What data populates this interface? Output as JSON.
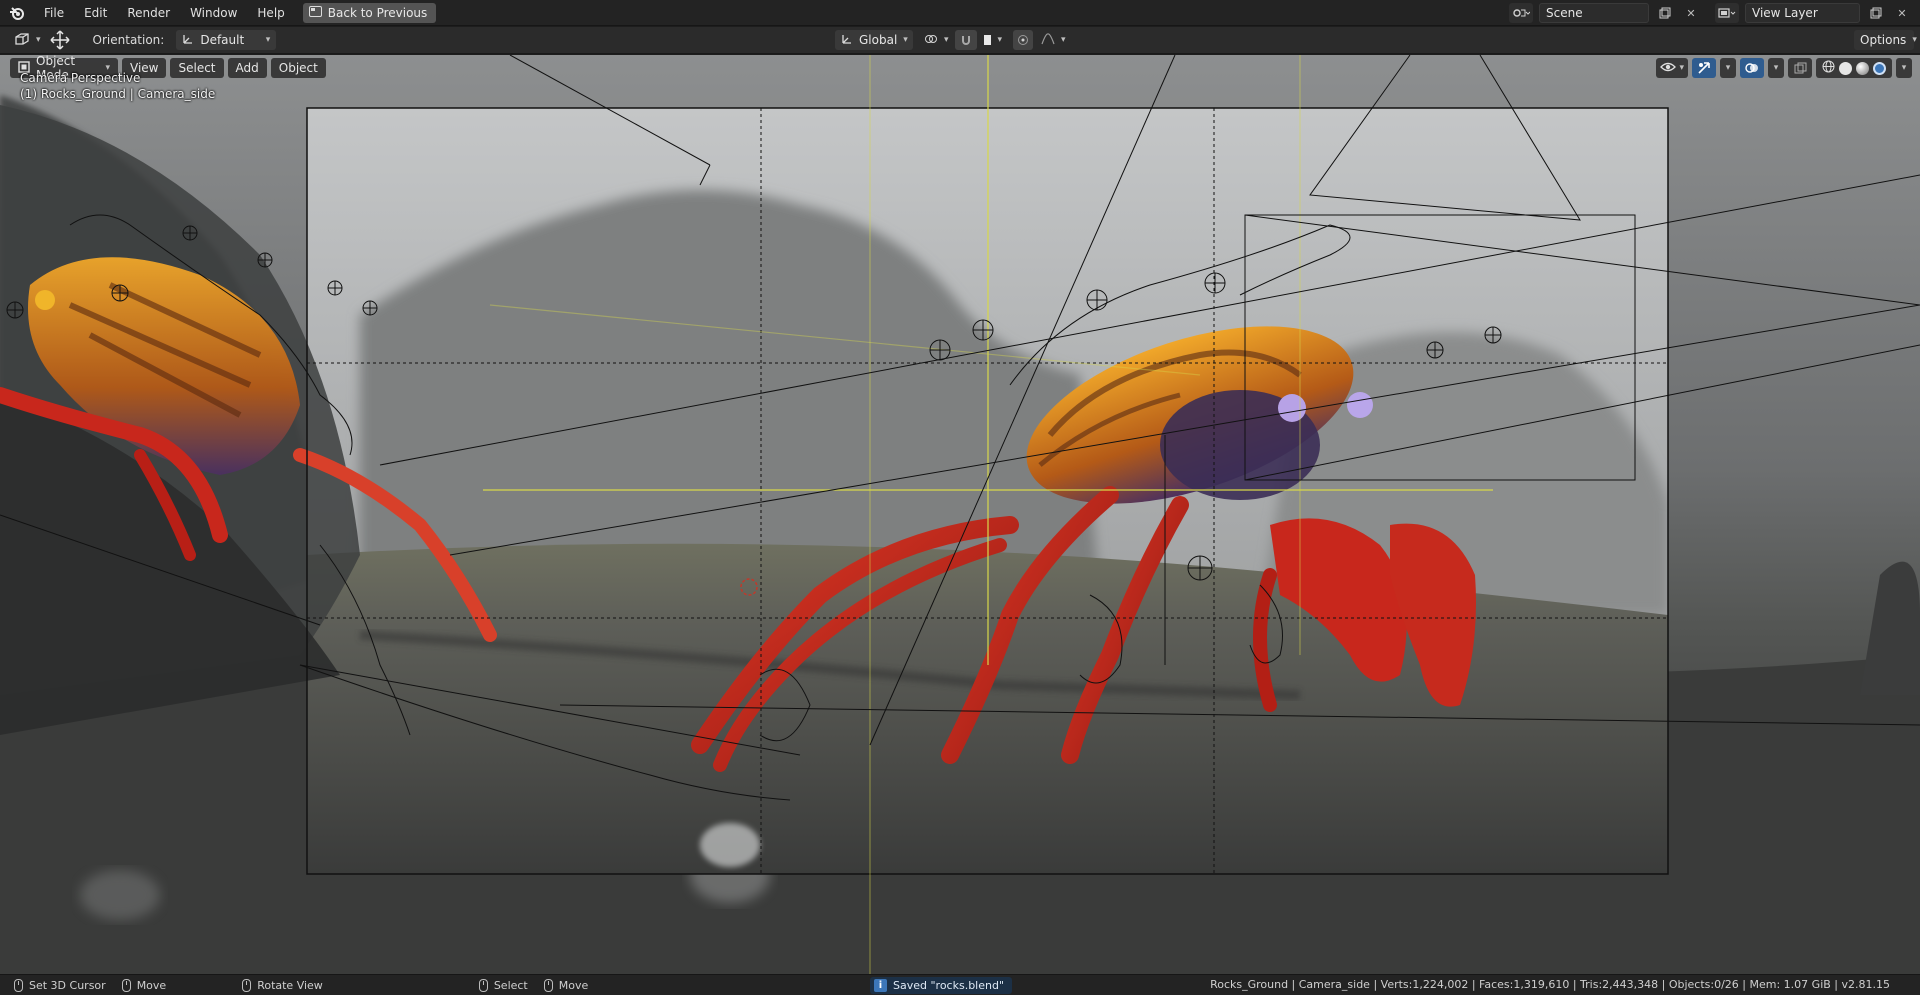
{
  "menubar": {
    "items": [
      "File",
      "Edit",
      "Render",
      "Window",
      "Help"
    ],
    "back_button": "Back to Previous",
    "scene_name": "Scene",
    "view_layer": "View Layer"
  },
  "toolbar": {
    "orientation_label": "Orientation:",
    "orientation_value": "Default",
    "transform_space": "Global"
  },
  "viewport": {
    "mode": "Object Mode",
    "menus": [
      "View",
      "Select",
      "Add",
      "Object"
    ],
    "overlay_line1": "Camera Perspective",
    "overlay_line2": "(1) Rocks_Ground | Camera_side",
    "options_label": "Options"
  },
  "statusbar": {
    "hints": [
      "Set 3D Cursor",
      "Move",
      "Rotate View",
      "Select",
      "Move"
    ],
    "message": "Saved \"rocks.blend\"",
    "stats": "Rocks_Ground | Camera_side | Verts:1,224,002 | Faces:1,319,610 | Tris:2,443,348 | Objects:0/26 | Mem: 1.07 GiB | v2.81.15"
  },
  "colors": {
    "accent_blue": "#3c76b8",
    "crab_red": "#c8271c",
    "crab_orange": "#e6941c",
    "camera_guide": "#d8d84a"
  }
}
